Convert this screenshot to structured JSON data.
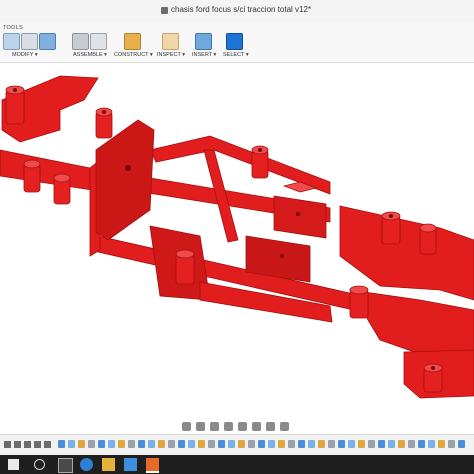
{
  "window": {
    "title": "chasis ford focus s/ci traccion total v12*"
  },
  "ribbon": {
    "tools_label": "TOOLS",
    "groups": [
      {
        "label": "MODIFY ▾"
      },
      {
        "label": "ASSEMBLE ▾"
      },
      {
        "label": "CONSTRUCT ▾"
      },
      {
        "label": "INSPECT ▾"
      },
      {
        "label": "INSERT ▾"
      },
      {
        "label": "SELECT ▾"
      }
    ]
  },
  "model": {
    "color": "#e11d1d",
    "shade_color": "#b31212",
    "highlight_color": "#f04a4a"
  },
  "colors": {
    "select_accent": "#1b74d6",
    "taskbar": "#1f1f1f"
  }
}
